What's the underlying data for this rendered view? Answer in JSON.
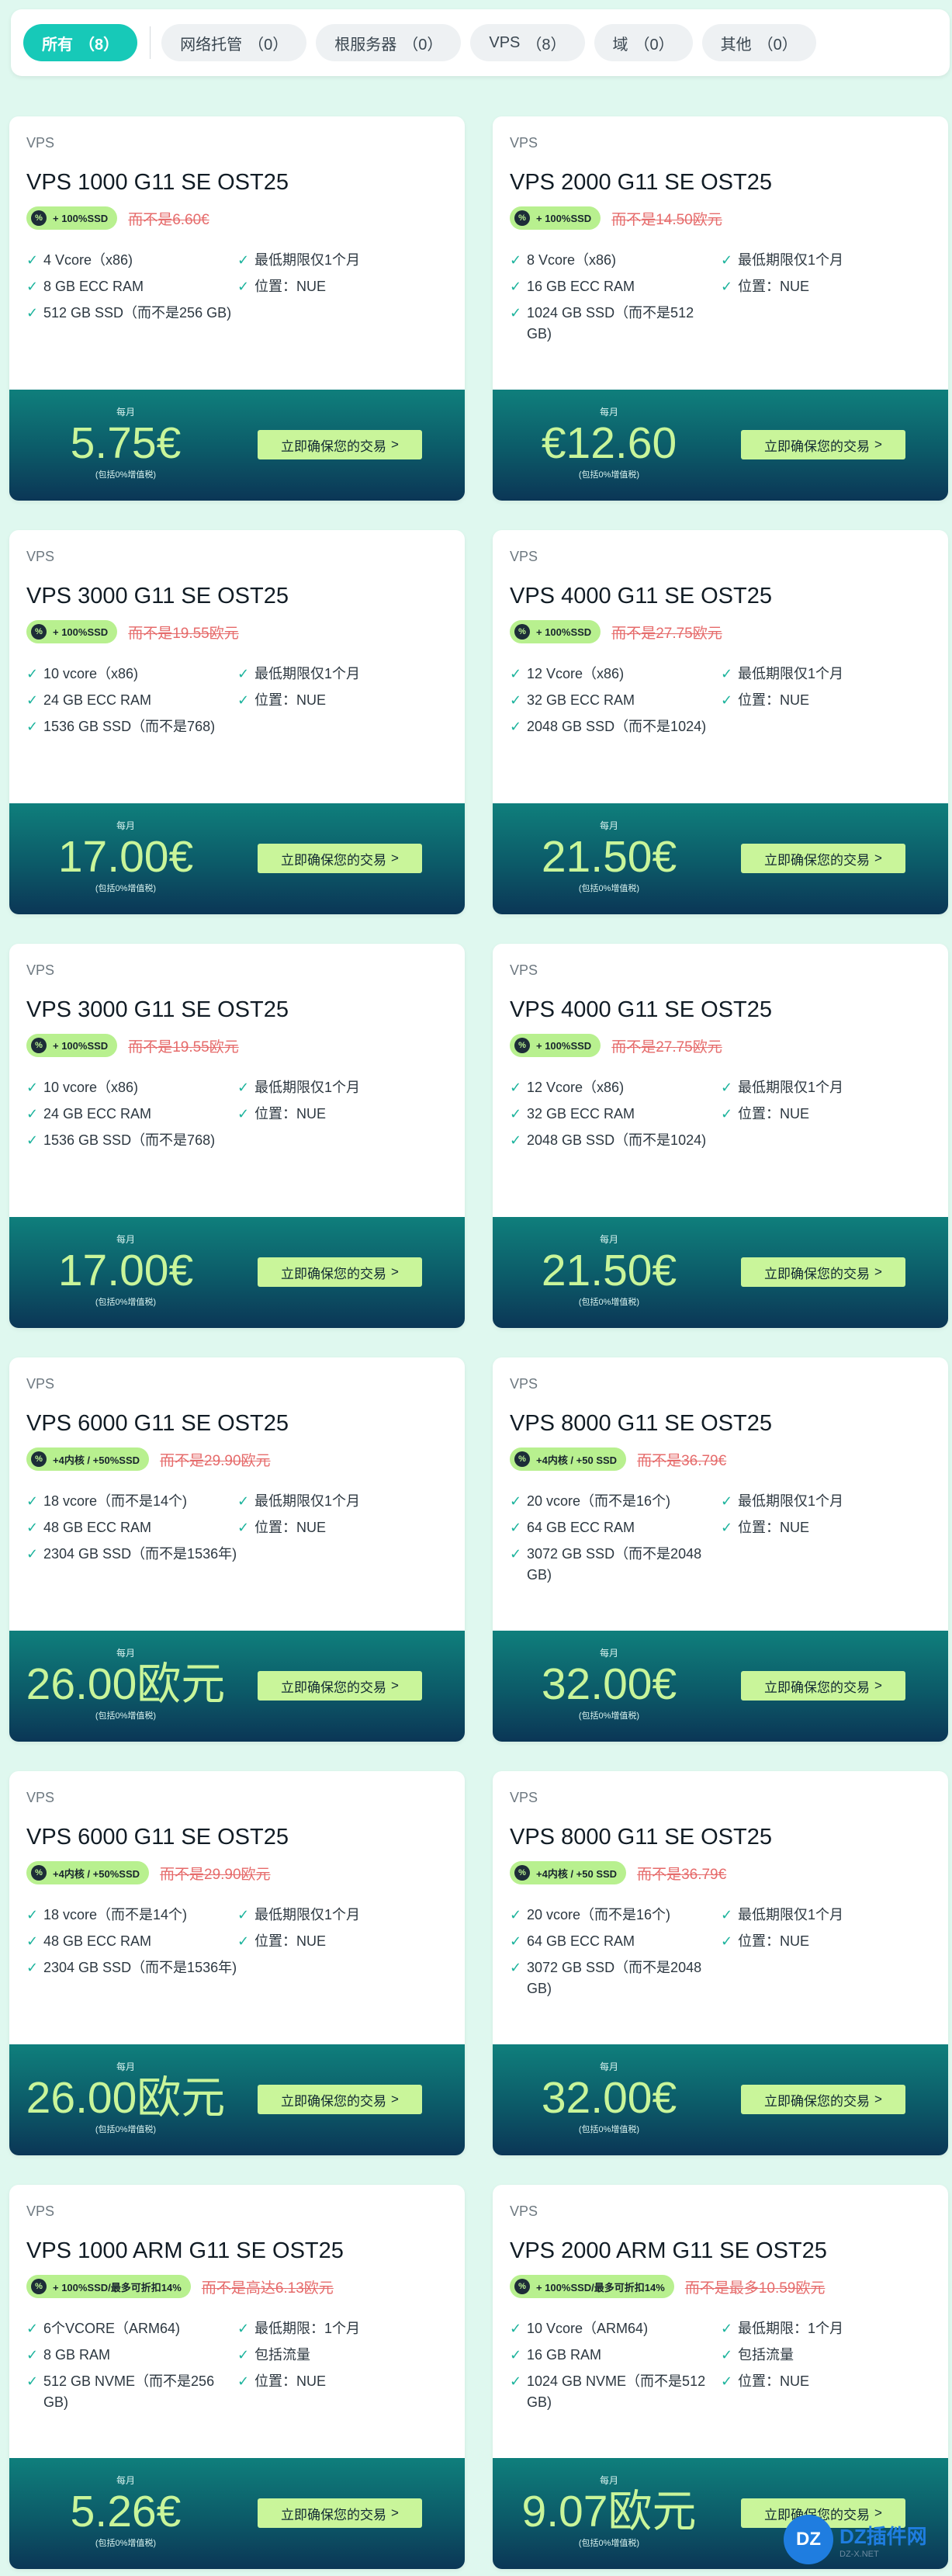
{
  "tabs": [
    {
      "label": "所有",
      "count": "（8）",
      "active": true
    },
    {
      "label": "网络托管",
      "count": "（0）",
      "active": false
    },
    {
      "label": "根服务器",
      "count": "（0）",
      "active": false
    },
    {
      "label": "VPS",
      "count": "（8）",
      "active": false
    },
    {
      "label": "域",
      "count": "（0）",
      "active": false
    },
    {
      "label": "其他",
      "count": "（0）",
      "active": false
    }
  ],
  "check_icon": "✓",
  "per_month": "每月",
  "vat_note": "(包括0%增值税)",
  "cta_label": "立即确保您的交易",
  "cta_arrow": ">",
  "cards": [
    {
      "category": "VPS",
      "title": "VPS 1000 G11 SE OST25",
      "badge": "+ 100%SSD",
      "old_price": "而不是6.60€",
      "specs_left": [
        "4 Vcore（x86)",
        "8 GB ECC RAM",
        "512 GB SSD（而不是256 GB)"
      ],
      "specs_right": [
        "最低期限仅1个月",
        "位置：NUE"
      ],
      "price": "5.75€"
    },
    {
      "category": "VPS",
      "title": "VPS 2000 G11 SE OST25",
      "badge": "+ 100%SSD",
      "old_price": "而不是14.50欧元",
      "specs_left": [
        "8 Vcore（x86)",
        "16 GB ECC RAM",
        "1024 GB SSD（而不是512 GB)"
      ],
      "specs_right": [
        "最低期限仅1个月",
        "位置：NUE"
      ],
      "price": "€12.60"
    },
    {
      "category": "VPS",
      "title": "VPS 3000 G11 SE OST25",
      "badge": "+ 100%SSD",
      "old_price": "而不是19.55欧元",
      "specs_left": [
        "10 vcore（x86)",
        "24 GB ECC RAM",
        "1536 GB SSD（而不是768)"
      ],
      "specs_right": [
        "最低期限仅1个月",
        "位置：NUE"
      ],
      "price": "17.00€"
    },
    {
      "category": "VPS",
      "title": "VPS 4000 G11 SE OST25",
      "badge": "+ 100%SSD",
      "old_price": "而不是27.75欧元",
      "specs_left": [
        "12 Vcore（x86)",
        "32 GB ECC RAM",
        "2048 GB SSD（而不是1024)"
      ],
      "specs_right": [
        "最低期限仅1个月",
        "位置：NUE"
      ],
      "price": "21.50€"
    },
    {
      "category": "VPS",
      "title": "VPS 3000 G11 SE OST25",
      "badge": "+ 100%SSD",
      "old_price": "而不是19.55欧元",
      "specs_left": [
        "10 vcore（x86)",
        "24 GB ECC RAM",
        "1536 GB SSD（而不是768)"
      ],
      "specs_right": [
        "最低期限仅1个月",
        "位置：NUE"
      ],
      "price": "17.00€"
    },
    {
      "category": "VPS",
      "title": "VPS 4000 G11 SE OST25",
      "badge": "+ 100%SSD",
      "old_price": "而不是27.75欧元",
      "specs_left": [
        "12 Vcore（x86)",
        "32 GB ECC RAM",
        "2048 GB SSD（而不是1024)"
      ],
      "specs_right": [
        "最低期限仅1个月",
        "位置：NUE"
      ],
      "price": "21.50€"
    },
    {
      "category": "VPS",
      "title": "VPS 6000 G11 SE OST25",
      "badge": "+4内核 / +50%SSD",
      "old_price": "而不是29.90欧元",
      "specs_left": [
        "18 vcore（而不是14个)",
        "48 GB ECC RAM",
        "2304 GB SSD（而不是1536年)"
      ],
      "specs_right": [
        "最低期限仅1个月",
        "位置：NUE"
      ],
      "price": "26.00欧元"
    },
    {
      "category": "VPS",
      "title": "VPS 8000 G11 SE OST25",
      "badge": "+4内核 / +50 SSD",
      "old_price": "而不是36.79€",
      "specs_left": [
        "20 vcore（而不是16个)",
        "64 GB ECC RAM",
        "3072 GB SSD（而不是2048 GB)"
      ],
      "specs_right": [
        "最低期限仅1个月",
        "位置：NUE"
      ],
      "price": "32.00€"
    },
    {
      "category": "VPS",
      "title": "VPS 6000 G11 SE OST25",
      "badge": "+4内核 / +50%SSD",
      "old_price": "而不是29.90欧元",
      "specs_left": [
        "18 vcore（而不是14个)",
        "48 GB ECC RAM",
        "2304 GB SSD（而不是1536年)"
      ],
      "specs_right": [
        "最低期限仅1个月",
        "位置：NUE"
      ],
      "price": "26.00欧元"
    },
    {
      "category": "VPS",
      "title": "VPS 8000 G11 SE OST25",
      "badge": "+4内核 / +50 SSD",
      "old_price": "而不是36.79€",
      "specs_left": [
        "20 vcore（而不是16个)",
        "64 GB ECC RAM",
        "3072 GB SSD（而不是2048 GB)"
      ],
      "specs_right": [
        "最低期限仅1个月",
        "位置：NUE"
      ],
      "price": "32.00€"
    },
    {
      "category": "VPS",
      "title": "VPS 1000 ARM G11 SE OST25",
      "badge": "+ 100%SSD/最多可折扣14%",
      "old_price": "而不是高达6.13欧元",
      "specs_left": [
        "6个VCORE（ARM64)",
        "8 GB RAM",
        "512 GB NVME（而不是256 GB)"
      ],
      "specs_right": [
        "最低期限：1个月",
        "包括流量",
        "位置：NUE"
      ],
      "price": "5.26€"
    },
    {
      "category": "VPS",
      "title": "VPS 2000 ARM G11 SE OST25",
      "badge": "+ 100%SSD/最多可折扣14%",
      "old_price": "而不是最多10.59欧元",
      "specs_left": [
        "10 Vcore（ARM64)",
        "16 GB RAM",
        "1024 GB NVME（而不是512 GB)"
      ],
      "specs_right": [
        "最低期限：1个月",
        "包括流量",
        "位置：NUE"
      ],
      "price": "9.07欧元"
    }
  ],
  "watermark": {
    "logo": "DZ",
    "name": "DZ插件网",
    "sub": "DZ-X.NET"
  }
}
